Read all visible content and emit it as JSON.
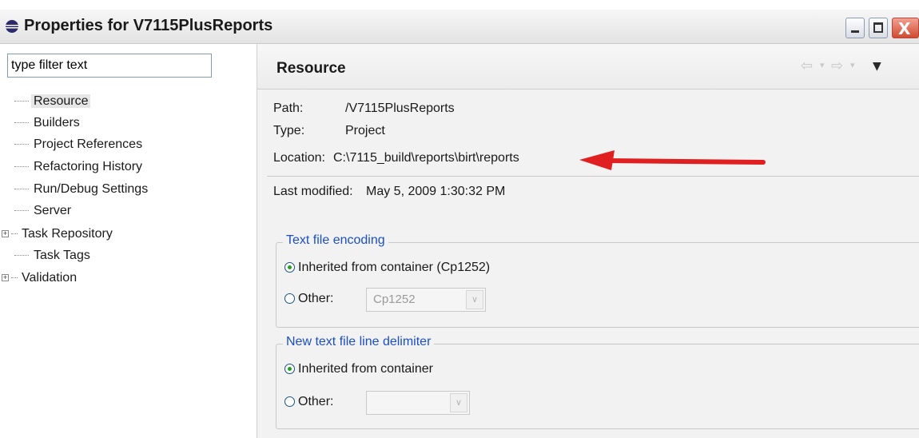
{
  "window": {
    "title": "Properties for V7115PlusReports",
    "close_glyph": "X"
  },
  "sidebar": {
    "filter_value": "type filter text",
    "items": [
      {
        "label": "Resource",
        "selected": true
      },
      {
        "label": "Builders"
      },
      {
        "label": "Project References"
      },
      {
        "label": "Refactoring History"
      },
      {
        "label": "Run/Debug Settings"
      },
      {
        "label": "Server"
      },
      {
        "label": "Task Repository",
        "expandable": true
      },
      {
        "label": "Task Tags"
      },
      {
        "label": "Validation",
        "expandable": true
      }
    ],
    "expander_glyph": "+"
  },
  "main": {
    "title": "Resource",
    "nav": {
      "back_icon": "⇦",
      "forward_icon": "⇨",
      "dropdown_icon": "▾",
      "menu_icon": "▼"
    },
    "path_label": "Path:",
    "path_value": "/V7115PlusReports",
    "type_label": "Type:",
    "type_value": "Project",
    "location_label": "Location:",
    "location_value": "C:\\7115_build\\reports\\birt\\reports",
    "last_modified_label": "Last modified:",
    "last_modified_value": "May 5, 2009 1:30:32 PM",
    "encoding": {
      "title": "Text file encoding",
      "inherited_label": "Inherited from container (Cp1252)",
      "other_label": "Other:",
      "other_value": "Cp1252",
      "selected": "inherited"
    },
    "line_delimiter": {
      "title": "New text file line delimiter",
      "inherited_label": "Inherited from container",
      "other_label": "Other:",
      "other_value": "",
      "selected": "inherited"
    }
  },
  "colors": {
    "annotation_arrow": "#e02020",
    "group_title": "#1b4fc3"
  }
}
